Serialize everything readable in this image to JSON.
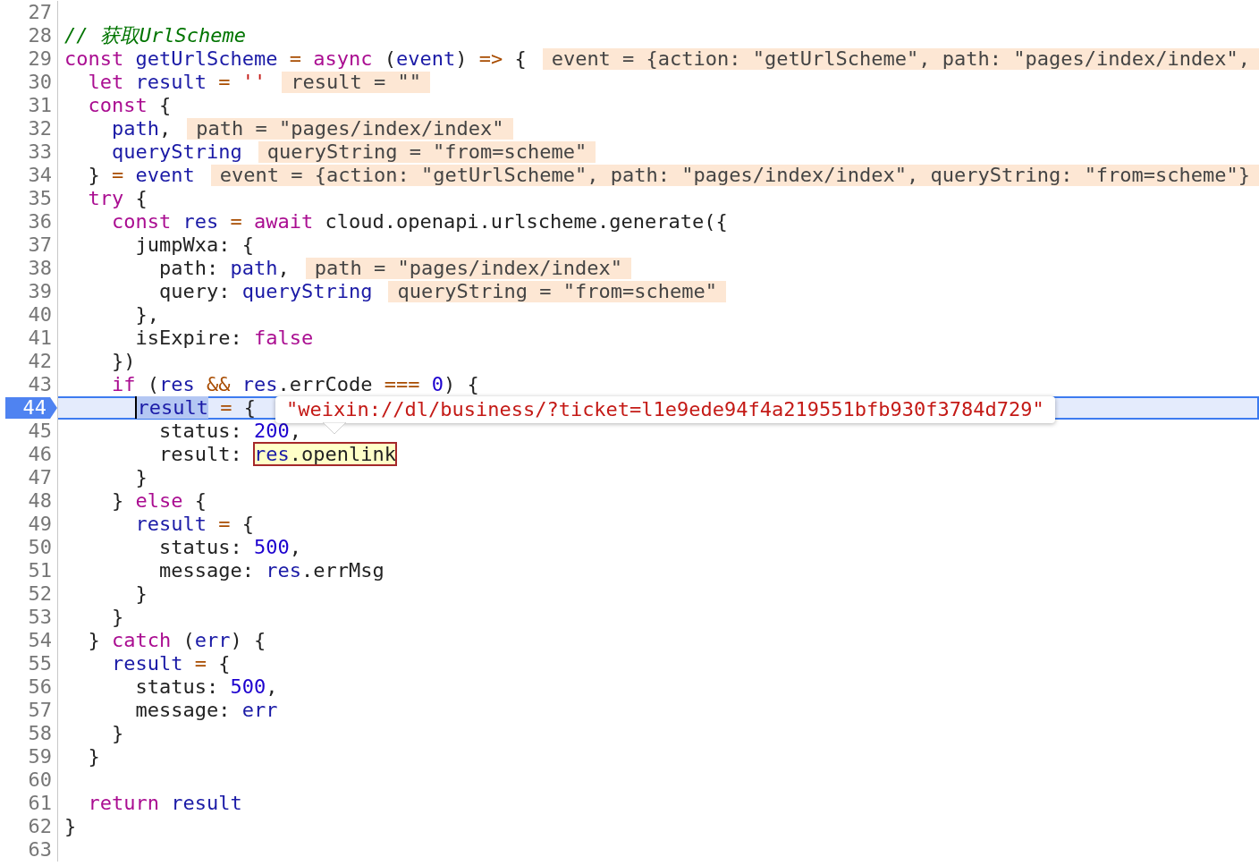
{
  "editor": {
    "lines": [
      {
        "number": "27",
        "current": false
      },
      {
        "number": "28",
        "current": false,
        "tokens": [
          {
            "text": "// 获取UrlScheme",
            "kind": "comment"
          }
        ]
      },
      {
        "number": "29",
        "current": false,
        "tokens": [
          {
            "text": "const",
            "kind": "keyword"
          },
          {
            "text": " getUrlScheme",
            "kind": "variable"
          },
          {
            "text": " =",
            "kind": "operator"
          },
          {
            "text": " async",
            "kind": "keyword"
          },
          {
            "text": " (",
            "kind": "plain"
          },
          {
            "text": "event",
            "kind": "variable"
          },
          {
            "text": ")",
            "kind": "plain"
          },
          {
            "text": " =>",
            "kind": "operator"
          },
          {
            "text": " {",
            "kind": "plain"
          }
        ],
        "inline": "event = {action: \"getUrlScheme\", path: \"pages/index/index\","
      },
      {
        "number": "30",
        "current": false,
        "tokens": [
          {
            "text": "  let",
            "kind": "keyword"
          },
          {
            "text": " result",
            "kind": "variable"
          },
          {
            "text": " =",
            "kind": "operator"
          },
          {
            "text": " ''",
            "kind": "string"
          }
        ],
        "inline": "result = \"\""
      },
      {
        "number": "31",
        "current": false,
        "tokens": [
          {
            "text": "  const",
            "kind": "keyword"
          },
          {
            "text": " {",
            "kind": "plain"
          }
        ]
      },
      {
        "number": "32",
        "current": false,
        "tokens": [
          {
            "text": "    path",
            "kind": "variable"
          },
          {
            "text": ",",
            "kind": "plain"
          }
        ],
        "inline": "path = \"pages/index/index\""
      },
      {
        "number": "33",
        "current": false,
        "tokens": [
          {
            "text": "    queryString",
            "kind": "variable"
          }
        ],
        "inline": "queryString = \"from=scheme\""
      },
      {
        "number": "34",
        "current": false,
        "tokens": [
          {
            "text": "  }",
            "kind": "plain"
          },
          {
            "text": " =",
            "kind": "operator"
          },
          {
            "text": " event",
            "kind": "variable"
          }
        ],
        "inline": "event = {action: \"getUrlScheme\", path: \"pages/index/index\", queryString: \"from=scheme\"}"
      },
      {
        "number": "35",
        "current": false,
        "tokens": [
          {
            "text": "  try",
            "kind": "keyword"
          },
          {
            "text": " {",
            "kind": "plain"
          }
        ]
      },
      {
        "number": "36",
        "current": false,
        "tokens": [
          {
            "text": "    const",
            "kind": "keyword"
          },
          {
            "text": " res",
            "kind": "variable"
          },
          {
            "text": " =",
            "kind": "operator"
          },
          {
            "text": " await",
            "kind": "keyword"
          },
          {
            "text": " cloud.openapi.urlscheme.generate({",
            "kind": "plain"
          }
        ]
      },
      {
        "number": "37",
        "current": false,
        "tokens": [
          {
            "text": "      jumpWxa: {",
            "kind": "plain"
          }
        ]
      },
      {
        "number": "38",
        "current": false,
        "tokens": [
          {
            "text": "        path: ",
            "kind": "plain"
          },
          {
            "text": "path",
            "kind": "variable"
          },
          {
            "text": ",",
            "kind": "plain"
          }
        ],
        "inline": "path = \"pages/index/index\""
      },
      {
        "number": "39",
        "current": false,
        "tokens": [
          {
            "text": "        query: ",
            "kind": "plain"
          },
          {
            "text": "queryString",
            "kind": "variable"
          }
        ],
        "inline": "queryString = \"from=scheme\""
      },
      {
        "number": "40",
        "current": false,
        "tokens": [
          {
            "text": "      },",
            "kind": "plain"
          }
        ]
      },
      {
        "number": "41",
        "current": false,
        "tokens": [
          {
            "text": "      isExpire: ",
            "kind": "plain"
          },
          {
            "text": "false",
            "kind": "keyword"
          }
        ]
      },
      {
        "number": "42",
        "current": false,
        "tokens": [
          {
            "text": "    })",
            "kind": "plain"
          }
        ]
      },
      {
        "number": "43",
        "current": false,
        "tokens": [
          {
            "text": "    if",
            "kind": "keyword"
          },
          {
            "text": " (",
            "kind": "plain"
          },
          {
            "text": "res",
            "kind": "variable"
          },
          {
            "text": " &&",
            "kind": "operator"
          },
          {
            "text": " res",
            "kind": "variable"
          },
          {
            "text": ".errCode",
            "kind": "plain"
          },
          {
            "text": " ===",
            "kind": "operator"
          },
          {
            "text": " 0",
            "kind": "number"
          },
          {
            "text": ") {",
            "kind": "plain"
          }
        ]
      },
      {
        "number": "44",
        "current": true,
        "tokens": [
          {
            "kind": "selection",
            "tokens": [
              {
                "text": "      result",
                "kind": "variable"
              }
            ]
          },
          {
            "text": " =",
            "kind": "operator"
          },
          {
            "text": " {",
            "kind": "plain"
          }
        ],
        "popover": "\"weixin://dl/business/?ticket=l1e9ede94f4a219551bfb930f3784d729\""
      },
      {
        "number": "45",
        "current": false,
        "tokens": [
          {
            "text": "        status: ",
            "kind": "plain"
          },
          {
            "text": "200",
            "kind": "number"
          },
          {
            "text": ",",
            "kind": "plain"
          }
        ]
      },
      {
        "number": "46",
        "current": false,
        "tokens": [
          {
            "text": "        result: ",
            "kind": "plain"
          },
          {
            "kind": "hover",
            "tokens": [
              {
                "text": "res",
                "kind": "variable"
              },
              {
                "text": ".openlink",
                "kind": "plain"
              }
            ]
          }
        ]
      },
      {
        "number": "47",
        "current": false,
        "tokens": [
          {
            "text": "      }",
            "kind": "plain"
          }
        ]
      },
      {
        "number": "48",
        "current": false,
        "tokens": [
          {
            "text": "    }",
            "kind": "plain"
          },
          {
            "text": " else",
            "kind": "keyword"
          },
          {
            "text": " {",
            "kind": "plain"
          }
        ]
      },
      {
        "number": "49",
        "current": false,
        "tokens": [
          {
            "text": "      result",
            "kind": "variable"
          },
          {
            "text": " =",
            "kind": "operator"
          },
          {
            "text": " {",
            "kind": "plain"
          }
        ]
      },
      {
        "number": "50",
        "current": false,
        "tokens": [
          {
            "text": "        status: ",
            "kind": "plain"
          },
          {
            "text": "500",
            "kind": "number"
          },
          {
            "text": ",",
            "kind": "plain"
          }
        ]
      },
      {
        "number": "51",
        "current": false,
        "tokens": [
          {
            "text": "        message: ",
            "kind": "plain"
          },
          {
            "text": "res",
            "kind": "variable"
          },
          {
            "text": ".errMsg",
            "kind": "plain"
          }
        ]
      },
      {
        "number": "52",
        "current": false,
        "tokens": [
          {
            "text": "      }",
            "kind": "plain"
          }
        ]
      },
      {
        "number": "53",
        "current": false,
        "tokens": [
          {
            "text": "    }",
            "kind": "plain"
          }
        ]
      },
      {
        "number": "54",
        "current": false,
        "tokens": [
          {
            "text": "  }",
            "kind": "plain"
          },
          {
            "text": " catch",
            "kind": "keyword"
          },
          {
            "text": " (",
            "kind": "plain"
          },
          {
            "text": "err",
            "kind": "variable"
          },
          {
            "text": ") {",
            "kind": "plain"
          }
        ]
      },
      {
        "number": "55",
        "current": false,
        "tokens": [
          {
            "text": "    result",
            "kind": "variable"
          },
          {
            "text": " =",
            "kind": "operator"
          },
          {
            "text": " {",
            "kind": "plain"
          }
        ]
      },
      {
        "number": "56",
        "current": false,
        "tokens": [
          {
            "text": "      status: ",
            "kind": "plain"
          },
          {
            "text": "500",
            "kind": "number"
          },
          {
            "text": ",",
            "kind": "plain"
          }
        ]
      },
      {
        "number": "57",
        "current": false,
        "tokens": [
          {
            "text": "      message: ",
            "kind": "plain"
          },
          {
            "text": "err",
            "kind": "variable"
          }
        ]
      },
      {
        "number": "58",
        "current": false,
        "tokens": [
          {
            "text": "    }",
            "kind": "plain"
          }
        ]
      },
      {
        "number": "59",
        "current": false,
        "tokens": [
          {
            "text": "  }",
            "kind": "plain"
          }
        ]
      },
      {
        "number": "60",
        "current": false
      },
      {
        "number": "61",
        "current": false,
        "tokens": [
          {
            "text": "  return",
            "kind": "keyword"
          },
          {
            "text": " result",
            "kind": "variable"
          }
        ]
      },
      {
        "number": "62",
        "current": false,
        "tokens": [
          {
            "text": "}",
            "kind": "plain"
          }
        ]
      },
      {
        "number": "63",
        "current": false
      }
    ]
  }
}
